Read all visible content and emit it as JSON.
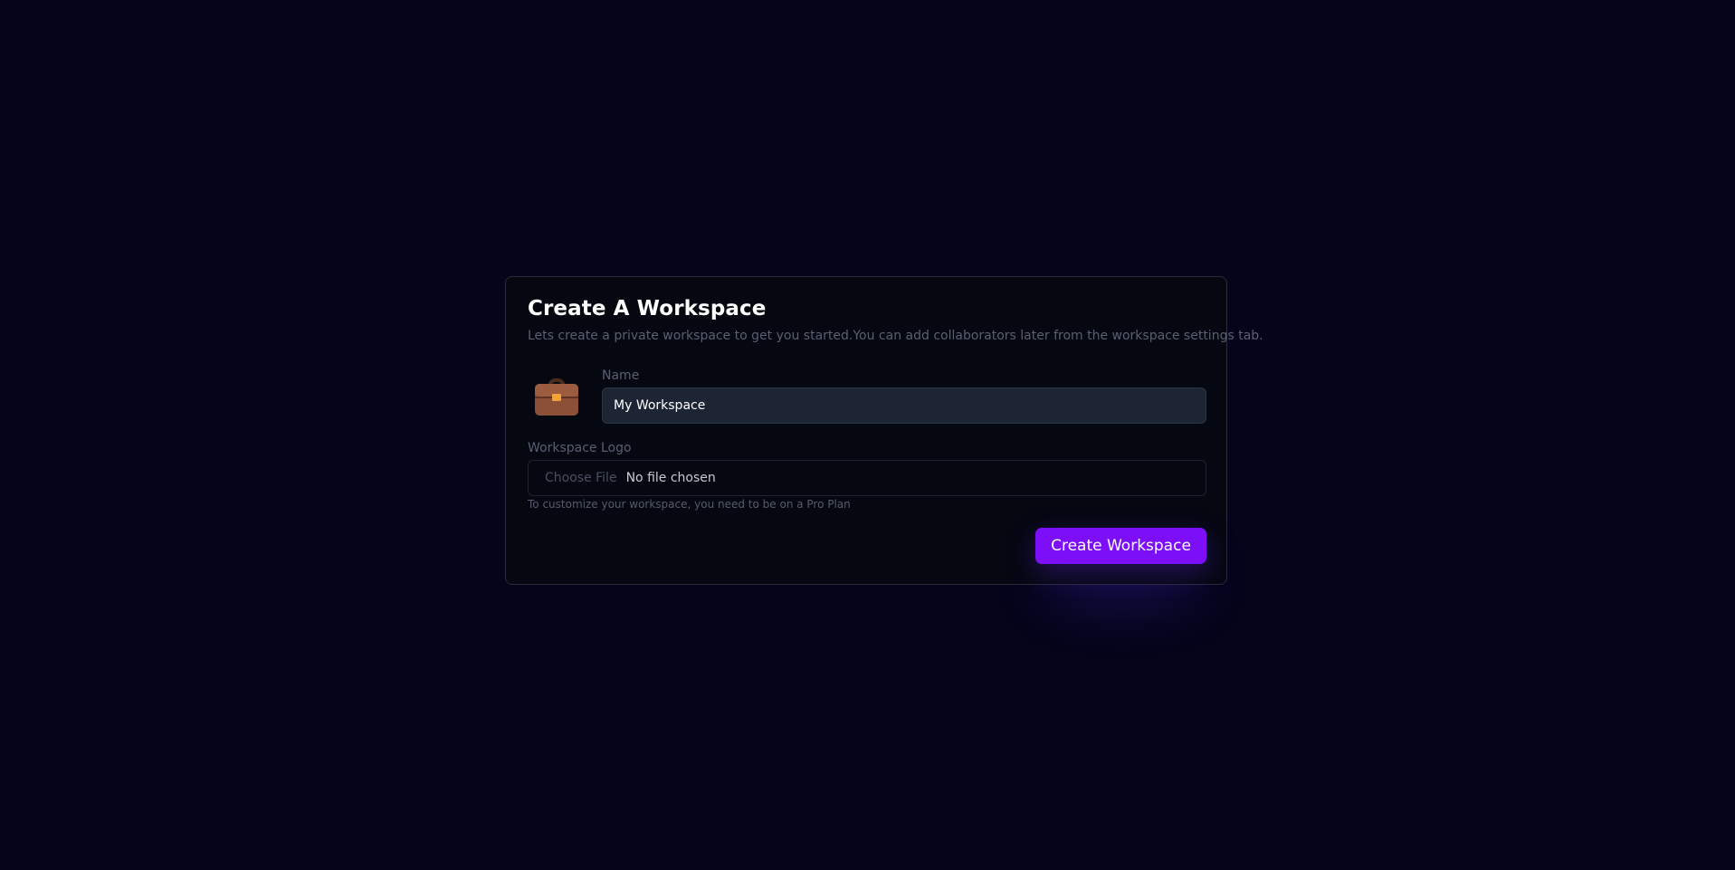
{
  "dialog": {
    "title": "Create A Workspace",
    "subtitle": "Lets create a private workspace to get you started.You can add collaborators later from the workspace settings tab."
  },
  "name_field": {
    "label": "Name",
    "value": "My Workspace",
    "emoji_icon": "briefcase-icon"
  },
  "logo_field": {
    "label": "Workspace Logo",
    "choose_label": "Choose File",
    "status": "No file chosen",
    "hint": "To customize your workspace, you need to be on a Pro Plan"
  },
  "submit": {
    "label": "Create Workspace"
  },
  "colors": {
    "background": "#05041a",
    "card": "#050711",
    "accent": "#7c0ff7",
    "input_bg": "#1d2534"
  }
}
